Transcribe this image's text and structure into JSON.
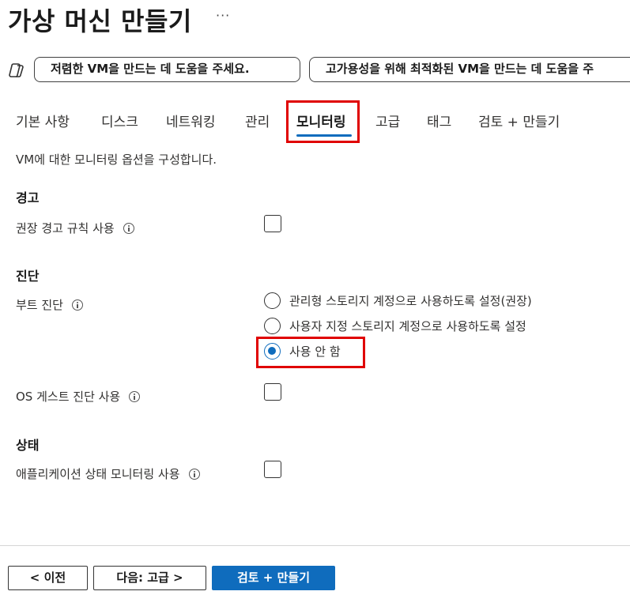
{
  "header": {
    "title": "가상 머신 만들기",
    "more_label": "···"
  },
  "suggestions": {
    "icon": "copilot-icon",
    "cheap_vm": "저렴한 VM을 만드는 데 도움을 주세요.",
    "ha_vm": "고가용성을 위해 최적화된 VM을 만드는 데 도움을 주"
  },
  "tabs": [
    {
      "label": "기본 사항"
    },
    {
      "label": "디스크"
    },
    {
      "label": "네트워킹"
    },
    {
      "label": "관리"
    },
    {
      "label": "모니터링",
      "active": true
    },
    {
      "label": "고급"
    },
    {
      "label": "태그"
    },
    {
      "label": "검토 + 만들기"
    }
  ],
  "description": "VM에 대한 모니터링 옵션을 구성합니다.",
  "alerts": {
    "heading": "경고",
    "recommended_rules_label": "권장 경고 규칙 사용",
    "recommended_rules_checked": false
  },
  "diagnostics": {
    "heading": "진단",
    "boot_label": "부트 진단",
    "boot_options": [
      {
        "label": "관리형 스토리지 계정으로 사용하도록 설정(권장)",
        "selected": false
      },
      {
        "label": "사용자 지정 스토리지 계정으로 사용하도록 설정",
        "selected": false
      },
      {
        "label": "사용 안 함",
        "selected": true
      }
    ],
    "guest_os_label": "OS 게스트 진단 사용",
    "guest_os_checked": false
  },
  "health": {
    "heading": "상태",
    "app_health_label": "애플리케이션 상태 모니터링 사용",
    "app_health_checked": false
  },
  "footer": {
    "prev_label": "< 이전",
    "next_label": "다음: 고급 >",
    "review_label": "검토 + 만들기"
  },
  "colors": {
    "accent": "#0f6cbd",
    "highlight": "#e00000"
  }
}
